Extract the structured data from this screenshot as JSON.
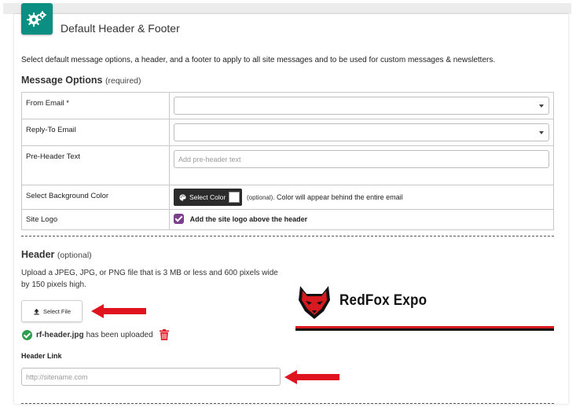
{
  "page": {
    "title": "Default Header & Footer",
    "intro": "Select default message options, a header, and a footer to apply to all site messages and to be used for custom messages & newsletters."
  },
  "message_options": {
    "title": "Message Options",
    "qualifier": "(required)",
    "rows": {
      "from_email": {
        "label": "From Email *",
        "value": ""
      },
      "reply_to": {
        "label": "Reply-To Email",
        "value": ""
      },
      "pre_header": {
        "label": "Pre-Header Text",
        "placeholder": "Add pre-header text",
        "value": ""
      },
      "bg_color": {
        "label": "Select Background Color",
        "button_label": "Select Color",
        "optional_tag": "(optional).",
        "note": "Color will appear behind the entire email",
        "swatch_color": "#ffffff"
      },
      "site_logo": {
        "label": "Site Logo",
        "checkbox_label": "Add the site logo above the header",
        "checked": true
      }
    }
  },
  "header": {
    "title": "Header",
    "qualifier": "(optional)",
    "help": "Upload a JPEG, JPG, or PNG file that is 3 MB or less and 600 pixels wide by 150 pixels high.",
    "select_file_label": "Select File",
    "uploaded_file": "rf-header.jpg",
    "uploaded_suffix": "has been uploaded",
    "link_label": "Header Link",
    "link_placeholder": "http://sitename.com",
    "preview_brand": "RedFox Expo"
  },
  "colors": {
    "accent_teal": "#0b8f82",
    "checkbox_purple": "#7b3f8c",
    "arrow_red": "#e0141e",
    "success_green": "#2e9d4d"
  },
  "icons": {
    "title_icon": "gears-icon",
    "upload_icon": "upload-icon",
    "palette_icon": "palette-icon",
    "success_icon": "check-circle-icon",
    "delete_icon": "trash-icon"
  }
}
